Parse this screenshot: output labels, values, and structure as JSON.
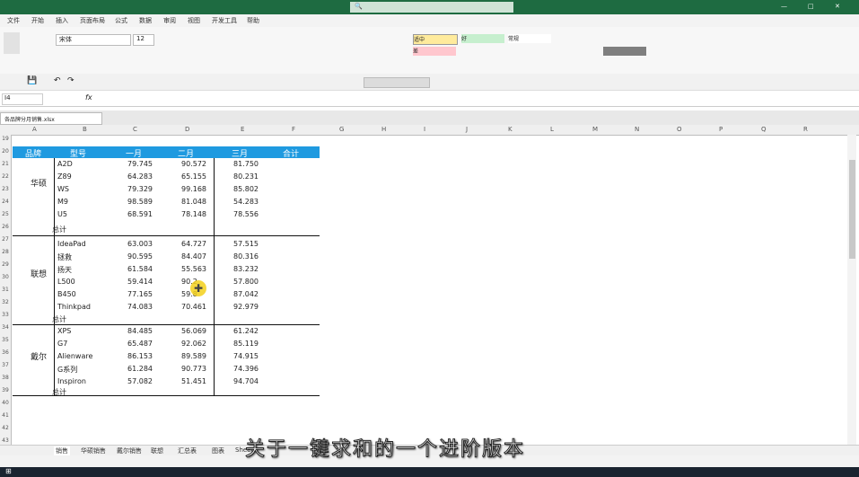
{
  "title": "",
  "search_placeholder": "",
  "menu": [
    "文件",
    "开始",
    "插入",
    "页面布局",
    "公式",
    "数据",
    "审阅",
    "视图",
    "开发工具",
    "帮助"
  ],
  "ribbon": {
    "font_name": "宋体",
    "font_size": "12",
    "styles": [
      "适中",
      "好",
      "差",
      "常规"
    ]
  },
  "formula_bar": {
    "cell_ref": "I4",
    "content": ""
  },
  "file_tab": "各品牌分月销售.xlsx",
  "columns": [
    "A",
    "B",
    "C",
    "D",
    "E",
    "F",
    "G",
    "H",
    "I",
    "J",
    "K",
    "L",
    "M",
    "N",
    "O",
    "P",
    "Q",
    "R"
  ],
  "rows": [
    "19",
    "20",
    "21",
    "22",
    "23",
    "24",
    "25",
    "26",
    "27",
    "28",
    "29",
    "30",
    "31",
    "32",
    "33",
    "34",
    "35",
    "36",
    "37",
    "38",
    "39",
    "40",
    "41",
    "42",
    "43"
  ],
  "table": {
    "headers": [
      "品牌",
      "型号",
      "一月",
      "二月",
      "三月",
      "合计"
    ],
    "groups": [
      {
        "brand": "华硕",
        "rows": [
          [
            "A2D",
            "79.745",
            "90.572",
            "81.750"
          ],
          [
            "Z89",
            "64.283",
            "65.155",
            "80.231"
          ],
          [
            "WS",
            "79.329",
            "99.168",
            "85.802"
          ],
          [
            "M9",
            "98.589",
            "81.048",
            "54.283"
          ],
          [
            "U5",
            "68.591",
            "78.148",
            "78.556"
          ]
        ],
        "subtotal": "总计"
      },
      {
        "brand": "联想",
        "rows": [
          [
            "IdeaPad",
            "63.003",
            "64.727",
            "57.515"
          ],
          [
            "拯救",
            "90.595",
            "84.407",
            "80.316"
          ],
          [
            "扬天",
            "61.584",
            "55.563",
            "83.232"
          ],
          [
            "L500",
            "59.414",
            "90.2",
            "57.800"
          ],
          [
            "B450",
            "77.165",
            "59.8",
            "87.042"
          ],
          [
            "Thinkpad",
            "74.083",
            "70.461",
            "92.979"
          ]
        ],
        "subtotal": "总计"
      },
      {
        "brand": "戴尔",
        "rows": [
          [
            "XPS",
            "84.485",
            "56.069",
            "61.242"
          ],
          [
            "G7",
            "65.487",
            "92.062",
            "85.119"
          ],
          [
            "Alienware",
            "86.153",
            "89.589",
            "74.915"
          ],
          [
            "G系列",
            "61.284",
            "90.773",
            "74.396"
          ],
          [
            "Inspiron",
            "57.082",
            "51.451",
            "94.704"
          ]
        ],
        "subtotal": "总计"
      }
    ]
  },
  "sheets": [
    "销售",
    "华硕销售",
    "戴尔销售",
    "联想",
    "汇总表",
    "图表",
    "Sheet1"
  ],
  "caption": "关于一键求和的一个进阶版本",
  "colors": {
    "title_green": "#1e6b41",
    "header_blue": "#1f9ae0"
  }
}
